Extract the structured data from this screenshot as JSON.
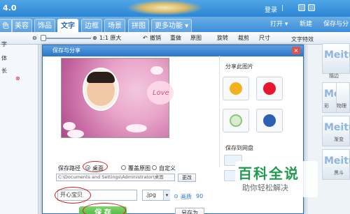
{
  "titlebar": {
    "version": "4.0",
    "login": "登录",
    "register": "|",
    "accent": "#2d86d3"
  },
  "tabs": {
    "items": [
      "色",
      "美容",
      "饰品",
      "文字",
      "边框",
      "场景",
      "拼图",
      "更多功能 ▾"
    ],
    "active_index": 3,
    "open_label": "打开 ▾",
    "new_label": "新建",
    "save_label": "保存与分"
  },
  "toolbar": {
    "ratio": "1:1 原大",
    "undo": "撤销",
    "redo": "重做",
    "original": "原图",
    "rotate": "旋转",
    "crop": "裁剪",
    "size": "尺寸",
    "right_title": "文字特效"
  },
  "left_panel": {
    "items": [
      "字",
      "体",
      "长",
      "⊗"
    ]
  },
  "right_panel": {
    "items": [
      {
        "logo": "Meitu",
        "label": ""
      },
      {
        "logo": "Meitu",
        "label": "描边"
      },
      {
        "logo": "Meitu",
        "label": "彩"
      },
      {
        "logo": "Meitu",
        "label": "物理"
      },
      {
        "logo": "Meitu",
        "label": "渐变"
      },
      {
        "logo": "Meitu",
        "label": "黑斗"
      }
    ]
  },
  "dialog": {
    "title": "保存与分享",
    "close_label": "×",
    "photo_text": "Love",
    "share_title": "分享此图片",
    "cloud_title": "保存到网盘",
    "save_path_label": "保存路径",
    "path_options": [
      "桌面",
      "覆盖原图",
      "自定义"
    ],
    "path_selected_index": 0,
    "path_value": "C:\\Documents and Settings\\Administrator\\桌面",
    "change_label": "更改",
    "filename": "开心宝贝",
    "extension": ".jpg",
    "quality_label": "画质",
    "quality_value": "90",
    "save_button": "保 存",
    "save_as_button": "另存为"
  },
  "watermark": {
    "line1": "百科全说",
    "line2": "助你轻松解决"
  }
}
